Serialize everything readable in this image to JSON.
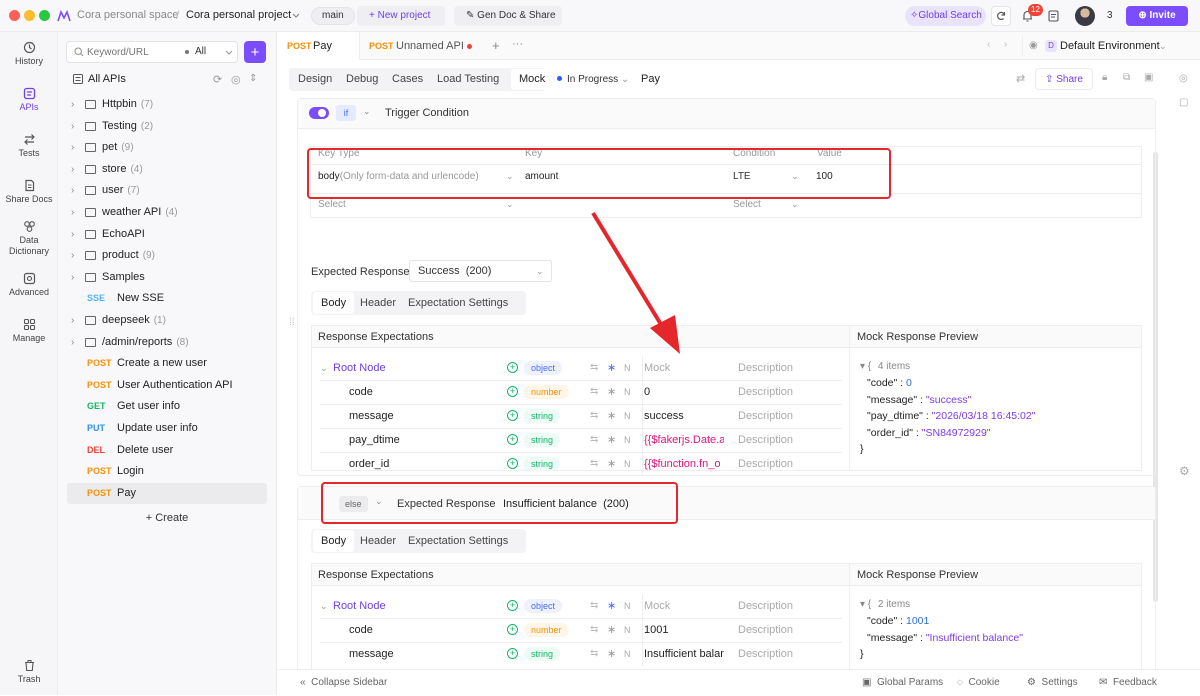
{
  "titlebar": {
    "space": "Cora personal space",
    "project": "Cora personal project",
    "branch": "main",
    "new_project": "New project",
    "gen_doc": "Gen Doc & Share",
    "global_search": "Global Search",
    "notif_count": "12",
    "member_count": "3",
    "invite": "Invite"
  },
  "rail": {
    "history": "History",
    "apis": "APIs",
    "tests": "Tests",
    "share_docs": "Share Docs",
    "data_dict_1": "Data",
    "data_dict_2": "Dictionary",
    "advanced": "Advanced",
    "manage": "Manage",
    "trash": "Trash"
  },
  "sidebar": {
    "search_placeholder": "Keyword/URL",
    "filter": "All",
    "all_apis": "All APIs",
    "folders": [
      {
        "name": "Httpbin",
        "count": "(7)"
      },
      {
        "name": "Testing",
        "count": "(2)"
      },
      {
        "name": "pet",
        "count": "(9)"
      },
      {
        "name": "store",
        "count": "(4)"
      },
      {
        "name": "user",
        "count": "(7)"
      },
      {
        "name": "weather API",
        "count": "(4)"
      },
      {
        "name": "EchoAPI",
        "count": ""
      },
      {
        "name": "product",
        "count": "(9)"
      },
      {
        "name": "Samples",
        "count": ""
      }
    ],
    "sse": {
      "method": "SSE",
      "name": "New SSE"
    },
    "folders2": [
      {
        "name": "deepseek",
        "count": "(1)"
      },
      {
        "name": "/admin/reports",
        "count": "(8)"
      }
    ],
    "apis": [
      {
        "method": "POST",
        "name": "Create a new user"
      },
      {
        "method": "POST",
        "name": "User Authentication API"
      },
      {
        "method": "GET",
        "name": "Get user info"
      },
      {
        "method": "PUT",
        "name": "Update user info"
      },
      {
        "method": "DEL",
        "name": "Delete user"
      },
      {
        "method": "POST",
        "name": "Login"
      },
      {
        "method": "POST",
        "name": "Pay"
      }
    ],
    "create": "Create"
  },
  "tabs": {
    "tab1_method": "POST",
    "tab1_name": "Pay",
    "tab2_method": "POST",
    "tab2_name": "Unnamed API",
    "env": "Default Environment",
    "env_letter": "D"
  },
  "subtabs": {
    "design": "Design",
    "debug": "Debug",
    "cases": "Cases",
    "load_testing": "Load Testing",
    "mock": "Mock",
    "status": "In Progress",
    "api_name": "Pay",
    "share": "Share"
  },
  "trigger": {
    "if_label": "if",
    "title": "Trigger Condition",
    "headers": {
      "key_type": "Key Type",
      "key": "Key",
      "condition": "Condition",
      "value": "Value"
    },
    "row1": {
      "key_type": "body",
      "key_type_hint": "(Only form-data and urlencode)",
      "key": "amount",
      "condition": "LTE",
      "value": "100"
    },
    "row2": {
      "key_type": "Select",
      "condition": "Select"
    }
  },
  "expected1": {
    "label": "Expected Response",
    "value": "Success",
    "code": "(200)",
    "tabs": {
      "body": "Body",
      "header": "Header",
      "settings": "Expectation Settings"
    },
    "resp_title": "Response Expectations",
    "preview_title": "Mock Response Preview",
    "root": {
      "name": "Root Node",
      "type": "object",
      "mock": "Mock",
      "desc": "Description"
    },
    "fields": [
      {
        "name": "code",
        "type": "number",
        "mock": "0",
        "desc": "Description"
      },
      {
        "name": "message",
        "type": "string",
        "mock": "success",
        "desc": "Description"
      },
      {
        "name": "pay_dtime",
        "type": "string",
        "mock": "{{$fakerjs.Date.a",
        "desc": "Description"
      },
      {
        "name": "order_id",
        "type": "string",
        "mock": "{{$function.fn_o",
        "desc": "Description"
      }
    ],
    "preview": {
      "items": "4 items",
      "lines": [
        {
          "k": "\"code\"",
          "v": "0",
          "t": "num"
        },
        {
          "k": "\"message\"",
          "v": "\"success\"",
          "t": "str"
        },
        {
          "k": "\"pay_dtime\"",
          "v": "\"2026/03/18 16:45:02\"",
          "t": "str"
        },
        {
          "k": "\"order_id\"",
          "v": "\"SN84972929\"",
          "t": "str"
        }
      ]
    }
  },
  "expected2": {
    "else_label": "else",
    "label": "Expected Response",
    "value": "Insufficient balance",
    "code": "(200)",
    "tabs": {
      "body": "Body",
      "header": "Header",
      "settings": "Expectation Settings"
    },
    "resp_title": "Response Expectations",
    "preview_title": "Mock Response Preview",
    "root": {
      "name": "Root Node",
      "type": "object",
      "mock": "Mock",
      "desc": "Description"
    },
    "fields": [
      {
        "name": "code",
        "type": "number",
        "mock": "1001",
        "desc": "Description"
      },
      {
        "name": "message",
        "type": "string",
        "mock": "Insufficient balan",
        "desc": "Description"
      }
    ],
    "preview": {
      "items": "2 items",
      "lines": [
        {
          "k": "\"code\"",
          "v": "1001",
          "t": "num"
        },
        {
          "k": "\"message\"",
          "v": "\"Insufficient balance\"",
          "t": "str"
        }
      ]
    }
  },
  "footer": {
    "collapse": "Collapse Sidebar",
    "global_params": "Global Params",
    "cookie": "Cookie",
    "settings": "Settings",
    "feedback": "Feedback"
  },
  "colors": {
    "accent": "#7c4dff",
    "red_highlight": "#e5262a",
    "number_chip": "#f79009",
    "string_chip": "#12b76a"
  }
}
